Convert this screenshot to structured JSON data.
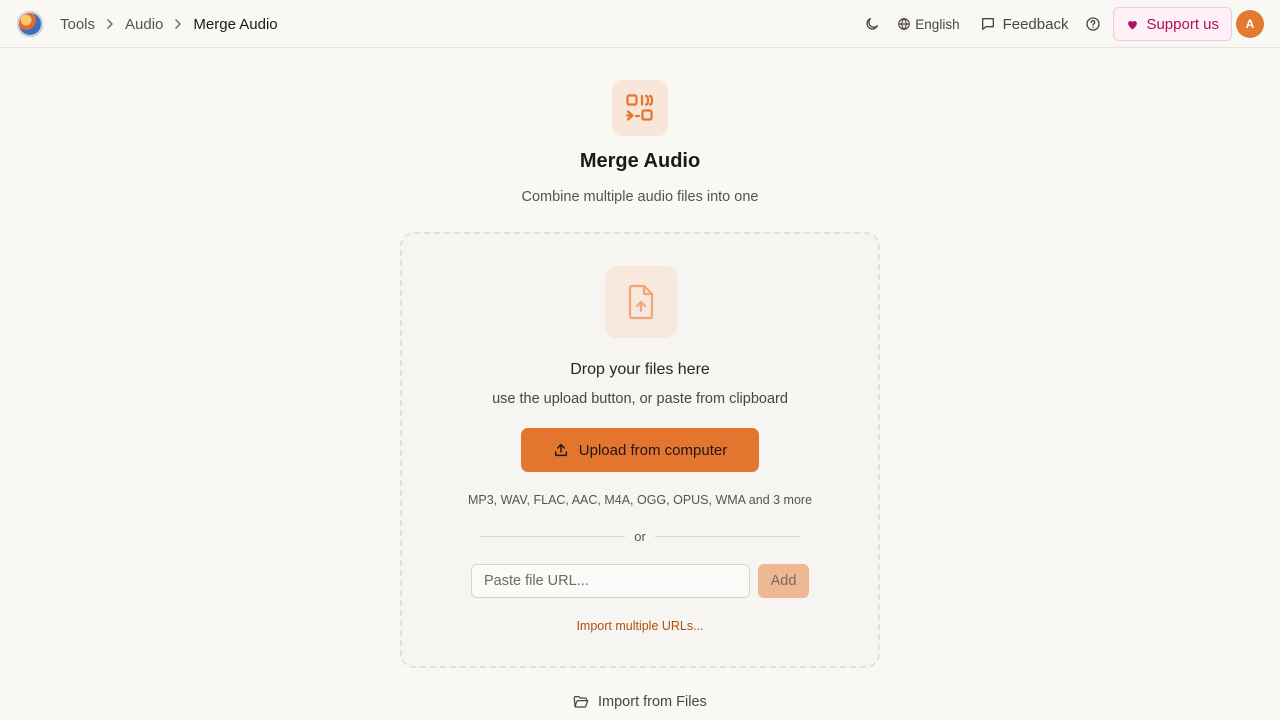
{
  "breadcrumb": {
    "items": [
      "Tools",
      "Audio"
    ],
    "current": "Merge Audio"
  },
  "header": {
    "language": "English",
    "feedback": "Feedback",
    "support": "Support us",
    "avatar_initial": "A"
  },
  "hero": {
    "title": "Merge Audio",
    "subtitle": "Combine multiple audio files into one"
  },
  "dropzone": {
    "title": "Drop your files here",
    "subtitle": "use the upload button, or paste from clipboard",
    "upload_label": "Upload from computer",
    "formats": "MP3, WAV, FLAC, AAC, M4A, OGG, OPUS, WMA and 3 more",
    "or": "or",
    "url_placeholder": "Paste file URL...",
    "add_label": "Add",
    "import_multiple": "Import multiple URLs..."
  },
  "import_files": "Import from Files",
  "colors": {
    "accent": "#e3752f",
    "support": "#b0105e",
    "link": "#b14f0e"
  }
}
